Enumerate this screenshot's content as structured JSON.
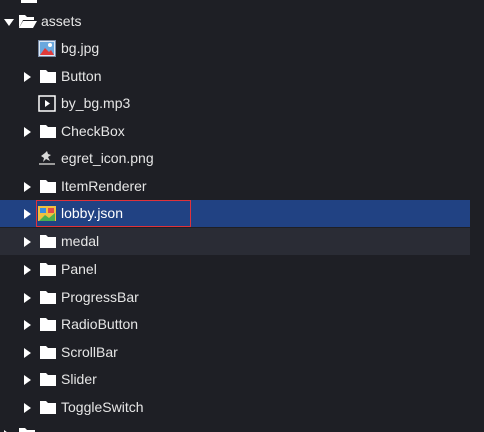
{
  "tree": {
    "items": [
      {
        "label": "assets",
        "kind": "folder-open"
      },
      {
        "label": "bg.jpg",
        "kind": "image-file"
      },
      {
        "label": "Button",
        "kind": "folder"
      },
      {
        "label": "by_bg.mp3",
        "kind": "media-file"
      },
      {
        "label": "CheckBox",
        "kind": "folder"
      },
      {
        "label": "egret_icon.png",
        "kind": "image-file"
      },
      {
        "label": "ItemRenderer",
        "kind": "folder"
      },
      {
        "label": "lobby.json",
        "kind": "json-file",
        "selected": true
      },
      {
        "label": "medal",
        "kind": "folder"
      },
      {
        "label": "Panel",
        "kind": "folder"
      },
      {
        "label": "ProgressBar",
        "kind": "folder"
      },
      {
        "label": "RadioButton",
        "kind": "folder"
      },
      {
        "label": "ScrollBar",
        "kind": "folder"
      },
      {
        "label": "Slider",
        "kind": "folder"
      },
      {
        "label": "ToggleSwitch",
        "kind": "folder"
      }
    ]
  },
  "colors": {
    "background": "#1e1f25",
    "selected": "#214283",
    "hover": "#2a2c35",
    "highlight": "#e0323a"
  }
}
